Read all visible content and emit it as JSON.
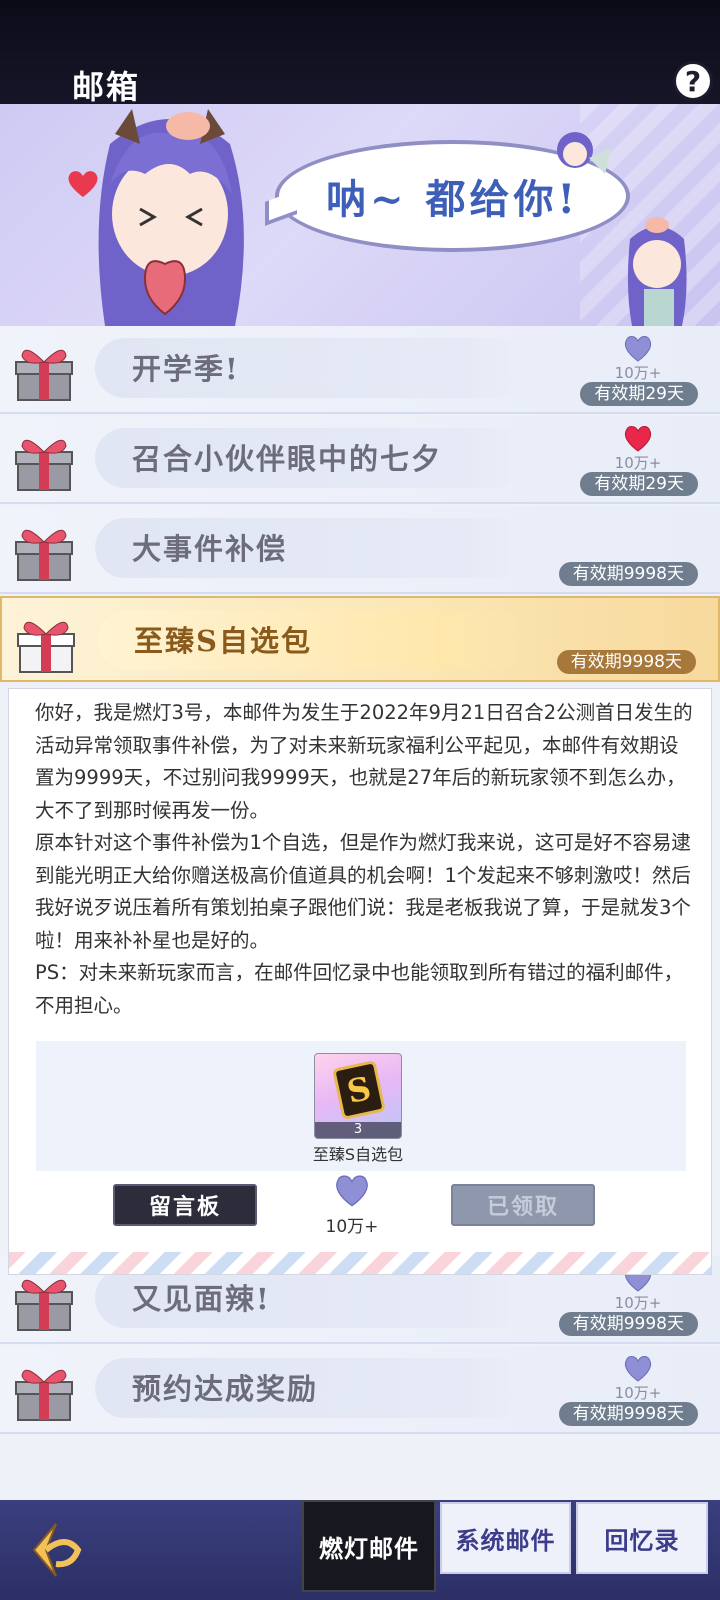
{
  "header": {
    "title": "邮箱",
    "help_label": "?"
  },
  "banner": {
    "speech": "呐~ 都给你!"
  },
  "mails": [
    {
      "name": "开学季!",
      "likes": "10万+",
      "expiry": "有效期29天",
      "liked": false
    },
    {
      "name": "召合小伙伴眼中的七夕",
      "likes": "10万+",
      "expiry": "有效期29天",
      "liked": true
    },
    {
      "name": "大事件补偿",
      "likes": "",
      "expiry": "有效期9998天",
      "liked": false
    },
    {
      "name": "至臻S自选包",
      "likes": "",
      "expiry": "有效期9998天",
      "liked": false
    },
    {
      "name": "又见面辣!",
      "likes": "10万+",
      "expiry": "有效期9998天",
      "liked": false
    },
    {
      "name": "预约达成奖励",
      "likes": "10万+",
      "expiry": "有效期9998天",
      "liked": false
    }
  ],
  "detail": {
    "paragraphs": [
      "你好，我是燃灯3号，本邮件为发生于2022年9月21日召合2公测首日发生的活动异常领取事件补偿，为了对未来新玩家福利公平起见，本邮件有效期设置为9999天，不过别问我9999天，也就是27年后的新玩家领不到怎么办，大不了到那时候再发一份。",
      "原本针对这个事件补偿为1个自选，但是作为燃灯我来说，这可是好不容易逮到能光明正大给你赠送极高价值道具的机会啊！1个发起来不够刺激哎！然后我好说歹说压着所有策划拍桌子跟他们说：我是老板我说了算，于是就发3个啦！用来补补星也是好的。",
      "PS：对未来新玩家而言，在邮件回忆录中也能领取到所有错过的福利邮件，不用担心。"
    ],
    "attachment": {
      "name": "至臻S自选包",
      "quantity": "3",
      "icon": "s-card-icon"
    },
    "board_label": "留言板",
    "likes": "10万+",
    "claimed_label": "已领取"
  },
  "tabs": [
    "燃灯邮件",
    "系统邮件",
    "回忆录"
  ],
  "colors": {
    "accent": "#e0b86a",
    "heart_active": "#e8274b",
    "heart_inactive": "#8f8fd6",
    "bottom_bar": "#2c2f66"
  }
}
